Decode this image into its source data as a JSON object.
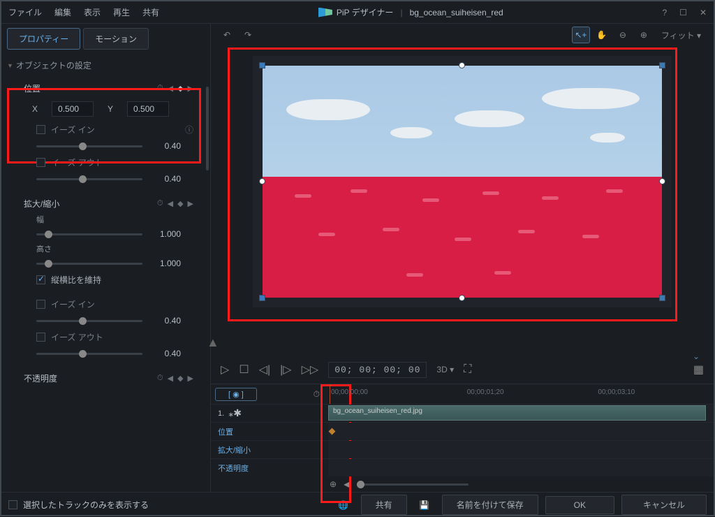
{
  "titlebar": {
    "menu": {
      "file": "ファイル",
      "edit": "編集",
      "view": "表示",
      "play": "再生",
      "share": "共有"
    },
    "app_name": "PiP デザイナー",
    "sep": "|",
    "doc_name": "bg_ocean_suiheisen_red"
  },
  "tabs": {
    "properties": "プロパティー",
    "motion": "モーション"
  },
  "sections": {
    "object_settings": "オブジェクトの設定"
  },
  "position": {
    "title": "位置",
    "x_label": "X",
    "x_value": "0.500",
    "y_label": "Y",
    "y_value": "0.500",
    "ease_in": "イーズ イン",
    "ease_in_val": "0.40",
    "ease_out": "イーズ アウト",
    "ease_out_val": "0.40"
  },
  "scale": {
    "title": "拡大/縮小",
    "width_label": "幅",
    "width_val": "1.000",
    "height_label": "高さ",
    "height_val": "1.000",
    "keep_aspect": "縦横比を維持",
    "ease_in": "イーズ イン",
    "ease_in_val": "0.40",
    "ease_out": "イーズ アウト",
    "ease_out_val": "0.40"
  },
  "opacity": {
    "title": "不透明度"
  },
  "canvas": {
    "fit_label": "フィット"
  },
  "playback": {
    "timecode": "00; 00; 00; 00",
    "mode_3d": "3D"
  },
  "timeline": {
    "ticks": [
      "00;00;00;00",
      "00;00;01;20",
      "00;00;03;10"
    ],
    "track_num": "1.",
    "clip_name": "bg_ocean_suiheisen_red.jpg",
    "rows": {
      "position": "位置",
      "scale": "拡大/縮小",
      "opacity": "不透明度"
    }
  },
  "bottom": {
    "show_selected_only": "選択したトラックのみを表示する",
    "share": "共有",
    "save_as": "名前を付けて保存",
    "ok": "OK",
    "cancel": "キャンセル"
  }
}
